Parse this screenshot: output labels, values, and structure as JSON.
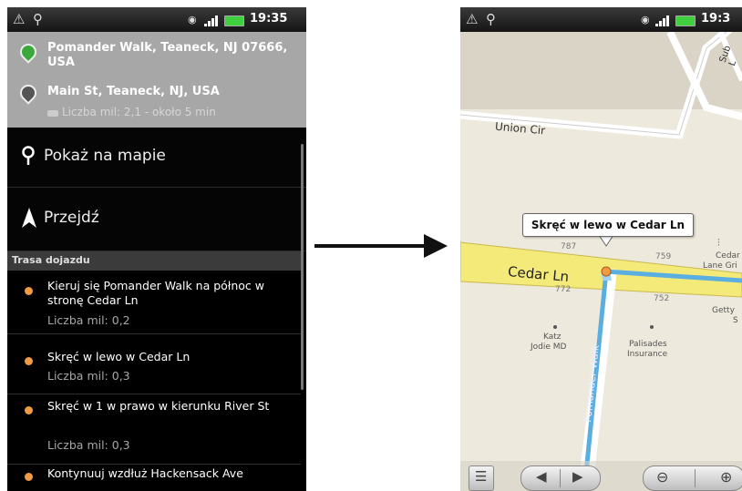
{
  "left_screen": {
    "status": {
      "time": "19:35"
    },
    "header": {
      "origin": "Pomander Walk, Teaneck, NJ 07666, USA",
      "destination": "Main St, Teaneck, NJ, USA",
      "summary": "Liczba mil: 2,1 - około 5 min"
    },
    "actions": [
      {
        "label": "Pokaż na mapie",
        "icon": "map-pin-icon"
      },
      {
        "label": "Przejdź",
        "icon": "navigation-arrow-icon"
      }
    ],
    "section_title": "Trasa dojazdu",
    "steps": [
      {
        "text": "Kieruj się Pomander Walk na północ w stronę Cedar Ln",
        "distance": "Liczba mil: 0,2"
      },
      {
        "text": "Skręć w lewo w Cedar Ln",
        "distance": "Liczba mil: 0,3"
      },
      {
        "text": "Skręć w 1 w prawo w kierunku River St",
        "distance": "Liczba mil: 0,3"
      },
      {
        "text": "Kontynuuj wzdłuż Hackensack Ave",
        "distance": ""
      }
    ]
  },
  "right_screen": {
    "status": {
      "time": "19:3"
    },
    "bubble": "Skręć w lewo w Cedar Ln",
    "labels": {
      "union_cir": "Union Cir",
      "cedar_ln": "Cedar Ln",
      "pomander_walk": "Pomander Walk",
      "sub": "Sub L",
      "n787": "787",
      "n772": "772",
      "n759": "759",
      "n752": "752",
      "katz1": "Katz",
      "katz2": "Jodie MD",
      "pal1": "Palisades",
      "pal2": "Insurance",
      "cedar_grill1": "Cedar",
      "cedar_grill2": "Lane Gri",
      "getty1": "Getty",
      "getty2": "S"
    }
  },
  "colors": {
    "accent_orange": "#f29a42",
    "route_blue": "#5aaee0",
    "road_yellow": "#f4ea7a"
  }
}
